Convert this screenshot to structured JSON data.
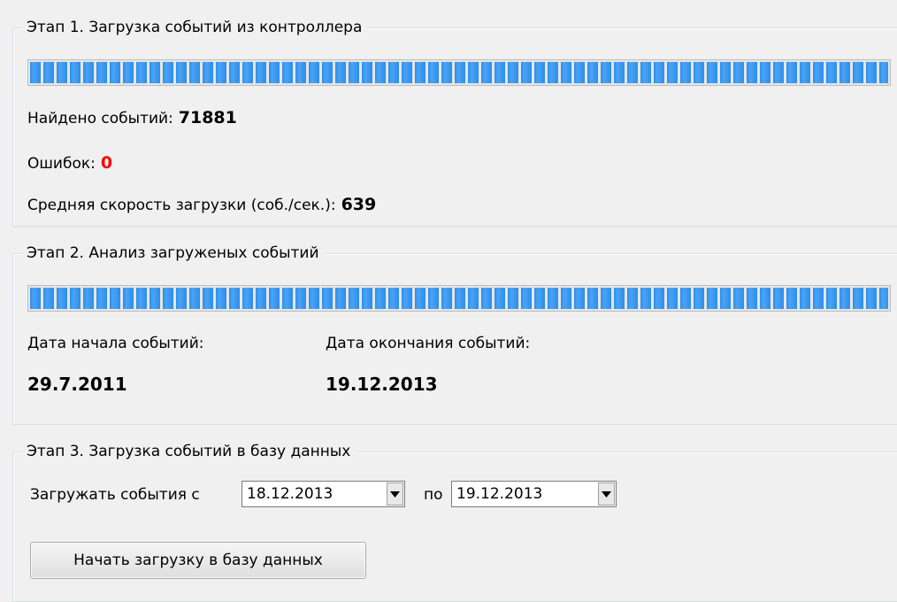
{
  "stage1": {
    "title": "Этап 1. Загрузка событий из контроллера",
    "progress_percent": 100,
    "found_label": "Найдено событий:",
    "found_value": "71881",
    "errors_label": "Ошибок:",
    "errors_value": "0",
    "speed_label": "Средняя скорость загрузки (соб./сек.):",
    "speed_value": "639"
  },
  "stage2": {
    "title": "Этап 2. Анализ загруженых событий",
    "progress_percent": 100,
    "start_label": "Дата начала событий:",
    "start_value": "29.7.2011",
    "end_label": "Дата окончания событий:",
    "end_value": "19.12.2013"
  },
  "stage3": {
    "title": "Этап 3. Загрузка событий в базу данных",
    "from_label": "Загружать события с",
    "from_value": "18.12.2013",
    "to_label": "по",
    "to_value": "19.12.2013",
    "start_button_label": "Начать загрузку в базу данных"
  },
  "colors": {
    "progress_fill": "#2e8de8",
    "error_value": "#ff0000"
  },
  "icons": {
    "dropdown": "chevron-down-icon"
  }
}
